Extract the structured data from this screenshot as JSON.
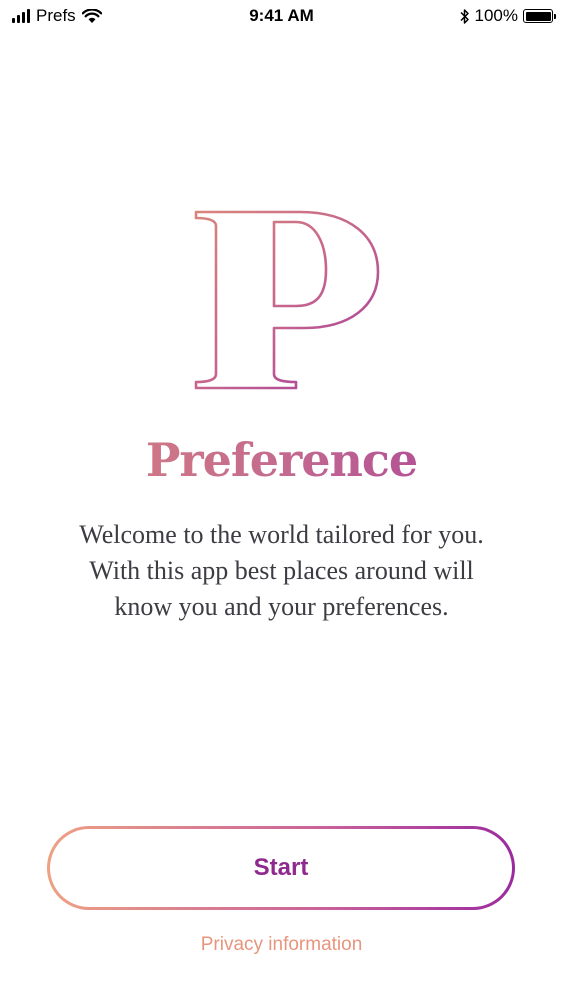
{
  "status_bar": {
    "carrier": "Prefs",
    "time": "9:41 AM",
    "battery_percent": "100%",
    "icons": [
      "signal-icon",
      "wifi-icon",
      "bluetooth-icon",
      "battery-icon"
    ]
  },
  "logo": {
    "letter": "P",
    "icon": "preference-logo-icon"
  },
  "app": {
    "title": "Preference"
  },
  "welcome": {
    "line1": "Welcome to the world tailored for you.",
    "line2": "With this app best places around will",
    "line3": "know you and your preferences."
  },
  "actions": {
    "start_label": "Start",
    "privacy_label": "Privacy information"
  },
  "colors": {
    "gradient_start": "#eea183",
    "gradient_mid": "#c9609a",
    "gradient_end": "#9b2a9e",
    "title_start": "#d9857c",
    "title_end": "#a23a9c",
    "body_text": "#3c3c43",
    "start_text": "#8e2a8e",
    "privacy_text": "#e8957e"
  }
}
